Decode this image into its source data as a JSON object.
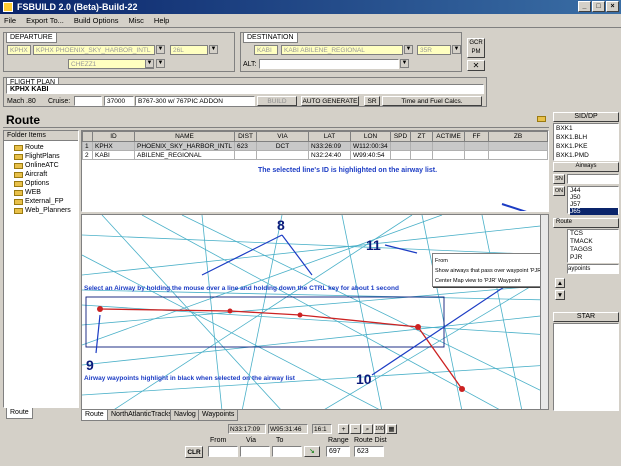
{
  "window": {
    "title": "FSBUILD 2.0 (Beta)-Build-22"
  },
  "menu": [
    "File",
    "Export To...",
    "Build Options",
    "Misc",
    "Help"
  ],
  "departure": {
    "label": "DEPARTURE",
    "icao": "KPHX",
    "name": "KPHX PHOENIX_SKY_HARBOR_INTL",
    "runway": "26L",
    "sid": "CHEZZ1"
  },
  "destination": {
    "label": "DESTINATION",
    "icao": "KABI",
    "name": "KABI ABILENE_REGIONAL",
    "runway": "35R",
    "alt_label": "ALT:"
  },
  "flight_plan": {
    "label": "FLIGHT PLAN",
    "route": "KPHX KABI",
    "mach_label": "Mach .80",
    "cruise_label": "Cruise:",
    "cruise_value": "37000",
    "aircraft": "B767-300 w/ 767PIC ADDON",
    "build_btn": "BUILD",
    "autogen_btn": "AUTO GENERATE",
    "sr_btn": "SR",
    "time_fuel_btn": "Time and Fuel Calcs."
  },
  "route_header": "Route",
  "folder_items": {
    "title": "Folder Items",
    "items": [
      "Route",
      "FlightPlans",
      "OnlineATC",
      "Aircraft",
      "Options",
      "WEB",
      "External_FP",
      "Web_Planners"
    ],
    "bottom_tab": "Route"
  },
  "table": {
    "columns": [
      "ID",
      "NAME",
      "DIST",
      "VIA",
      "LAT",
      "LON",
      "SPD",
      "ZT",
      "ACTIME",
      "FF",
      "ZB"
    ],
    "rows": [
      {
        "num": "1",
        "id": "KPHX",
        "name": "PHOENIX_SKY_HARBOR_INTL",
        "dist": "623",
        "via": "DCT",
        "lat": "N33:26:09",
        "lon": "W112:00:34"
      },
      {
        "num": "2",
        "id": "KABI",
        "name": "ABILENE_REGIONAL",
        "dist": "",
        "via": "",
        "lat": "N32:24:40",
        "lon": "W99:40:54"
      }
    ]
  },
  "annotations": {
    "airway_highlight": "The selected line's ID is highlighted on the airway list.",
    "select_airway": "Select an Airway by holding the mouse over a line and holding down the CTRL key for about 1 second",
    "waypoints_black": "Airway waypoints highlight in black when selected on the airway list",
    "n8": "8",
    "n9": "9",
    "n10": "10",
    "n11": "11"
  },
  "context_menu": {
    "items": [
      "From",
      "Show airways that pass over waypoint 'PJR'",
      "Center Map view to 'PJR' Waypoint"
    ]
  },
  "bottom_tabs": [
    "Route",
    "NorthAtlanticTracks",
    "Navlog",
    "Waypoints"
  ],
  "status": {
    "coords": "N33:17:09 W95:31:46",
    "lat": "N33:17:09",
    "lon": "W95:31:46",
    "zoom": "16:1",
    "from_label": "From",
    "via_label": "Via",
    "to_label": "To",
    "clr": "CLR",
    "range_label": "Range",
    "range_value": "697",
    "route_dist_label": "Route Dist",
    "route_dist_value": "623"
  },
  "right_panel": {
    "sid_title": "SID/DP",
    "sid_items": [
      "BXK1",
      "BXK1.BLH",
      "BXK1.PKE",
      "BXK1.PMD"
    ],
    "airways_title": "Airways",
    "sn": "SN",
    "on": "ON",
    "airway_items": [
      "J44",
      "J50",
      "J57",
      "J65"
    ],
    "route_title": "Route",
    "route_items": [
      "TCS",
      "TMACK",
      "TAGGS",
      "PJR"
    ],
    "waypoints_label": "aypoints",
    "star_title": "STAR"
  },
  "colors": {
    "title_bar": "#0a246a",
    "route_line": "#cc2222",
    "airway_lines": "#4ab0c8",
    "annotation_text": "#1c3cc4"
  }
}
